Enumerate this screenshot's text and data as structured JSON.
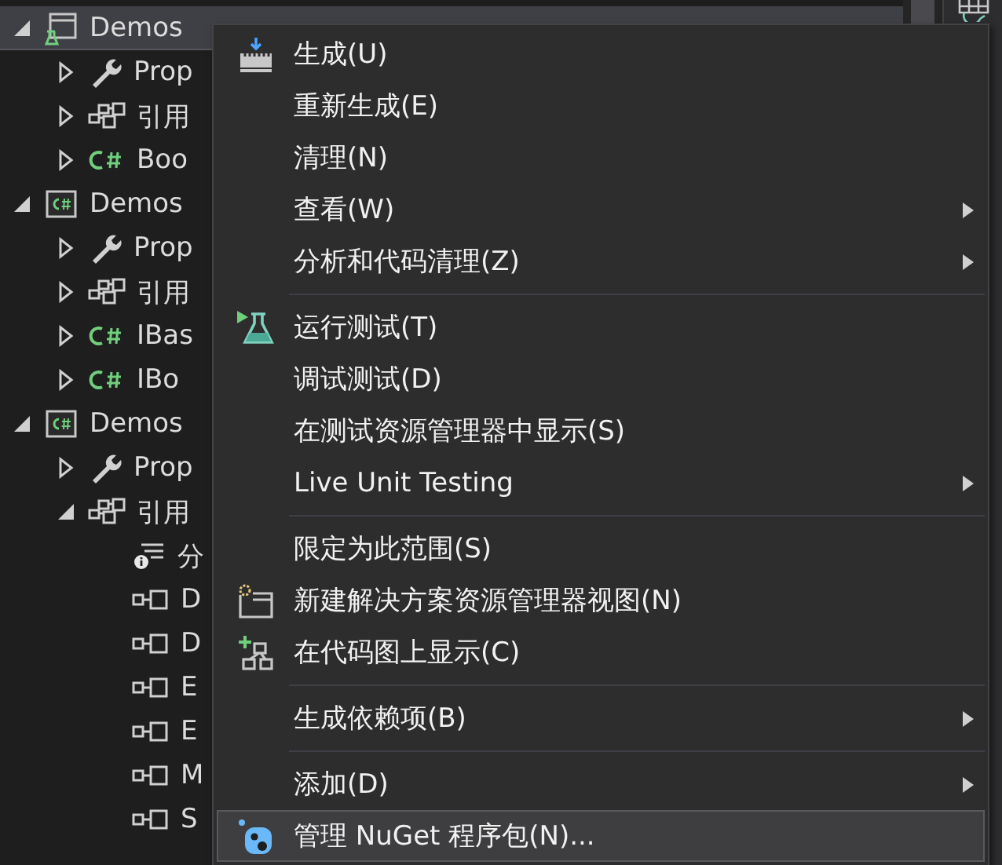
{
  "tree": [
    {
      "label": "Demos",
      "kind": "test-project",
      "expanded": true,
      "selected": true,
      "children": [
        {
          "label": "Prop",
          "kind": "properties",
          "expanded": false,
          "selected": false
        },
        {
          "label": "引用",
          "kind": "references",
          "expanded": false,
          "selected": false
        },
        {
          "label": "Boo",
          "kind": "csharp-file",
          "expanded": false,
          "selected": false
        }
      ]
    },
    {
      "label": "Demos",
      "kind": "project",
      "expanded": true,
      "selected": false,
      "children": [
        {
          "label": "Prop",
          "kind": "properties",
          "expanded": false,
          "selected": false
        },
        {
          "label": "引用",
          "kind": "references",
          "expanded": false,
          "selected": false
        },
        {
          "label": "IBas",
          "kind": "csharp-file",
          "expanded": false,
          "selected": false
        },
        {
          "label": "IBo",
          "kind": "csharp-file",
          "expanded": false,
          "selected": false
        }
      ]
    },
    {
      "label": "Demos",
      "kind": "project",
      "expanded": true,
      "selected": false,
      "children": [
        {
          "label": "Prop",
          "kind": "properties",
          "expanded": false,
          "selected": false
        },
        {
          "label": "引用",
          "kind": "references",
          "expanded": true,
          "selected": false,
          "children": [
            {
              "label": "分",
              "kind": "analyzers",
              "selected": false
            },
            {
              "label": "D",
              "kind": "reference",
              "selected": false
            },
            {
              "label": "D",
              "kind": "reference",
              "selected": false
            },
            {
              "label": "E",
              "kind": "reference",
              "selected": false
            },
            {
              "label": "E",
              "kind": "reference",
              "selected": false
            },
            {
              "label": "M",
              "kind": "reference",
              "selected": false
            },
            {
              "label": "S",
              "kind": "reference",
              "selected": false
            }
          ]
        }
      ]
    }
  ],
  "context_menu": {
    "items": [
      {
        "kind": "build",
        "label": "生成(U)",
        "submenu": false,
        "selected": false
      },
      {
        "kind": "plain",
        "label": "重新生成(E)",
        "submenu": false,
        "selected": false
      },
      {
        "kind": "plain",
        "label": "清理(N)",
        "submenu": false,
        "selected": false
      },
      {
        "kind": "plain",
        "label": "查看(W)",
        "submenu": true,
        "selected": false
      },
      {
        "kind": "plain",
        "label": "分析和代码清理(Z)",
        "submenu": true,
        "selected": false
      },
      {
        "kind": "separator"
      },
      {
        "kind": "run-tests",
        "label": "运行测试(T)",
        "submenu": false,
        "selected": false
      },
      {
        "kind": "plain",
        "label": "调试测试(D)",
        "submenu": false,
        "selected": false
      },
      {
        "kind": "plain",
        "label": "在测试资源管理器中显示(S)",
        "submenu": false,
        "selected": false
      },
      {
        "kind": "plain",
        "label": "Live Unit Testing",
        "submenu": true,
        "selected": false
      },
      {
        "kind": "separator"
      },
      {
        "kind": "plain",
        "label": "限定为此范围(S)",
        "submenu": false,
        "selected": false
      },
      {
        "kind": "new-view",
        "label": "新建解决方案资源管理器视图(N)",
        "submenu": false,
        "selected": false
      },
      {
        "kind": "code-map",
        "label": "在代码图上显示(C)",
        "submenu": false,
        "selected": false
      },
      {
        "kind": "separator"
      },
      {
        "kind": "plain",
        "label": "生成依赖项(B)",
        "submenu": true,
        "selected": false
      },
      {
        "kind": "separator"
      },
      {
        "kind": "plain",
        "label": "添加(D)",
        "submenu": true,
        "selected": false
      },
      {
        "kind": "nuget",
        "label": "管理 NuGet 程序包(N)...",
        "submenu": false,
        "selected": true
      }
    ]
  }
}
